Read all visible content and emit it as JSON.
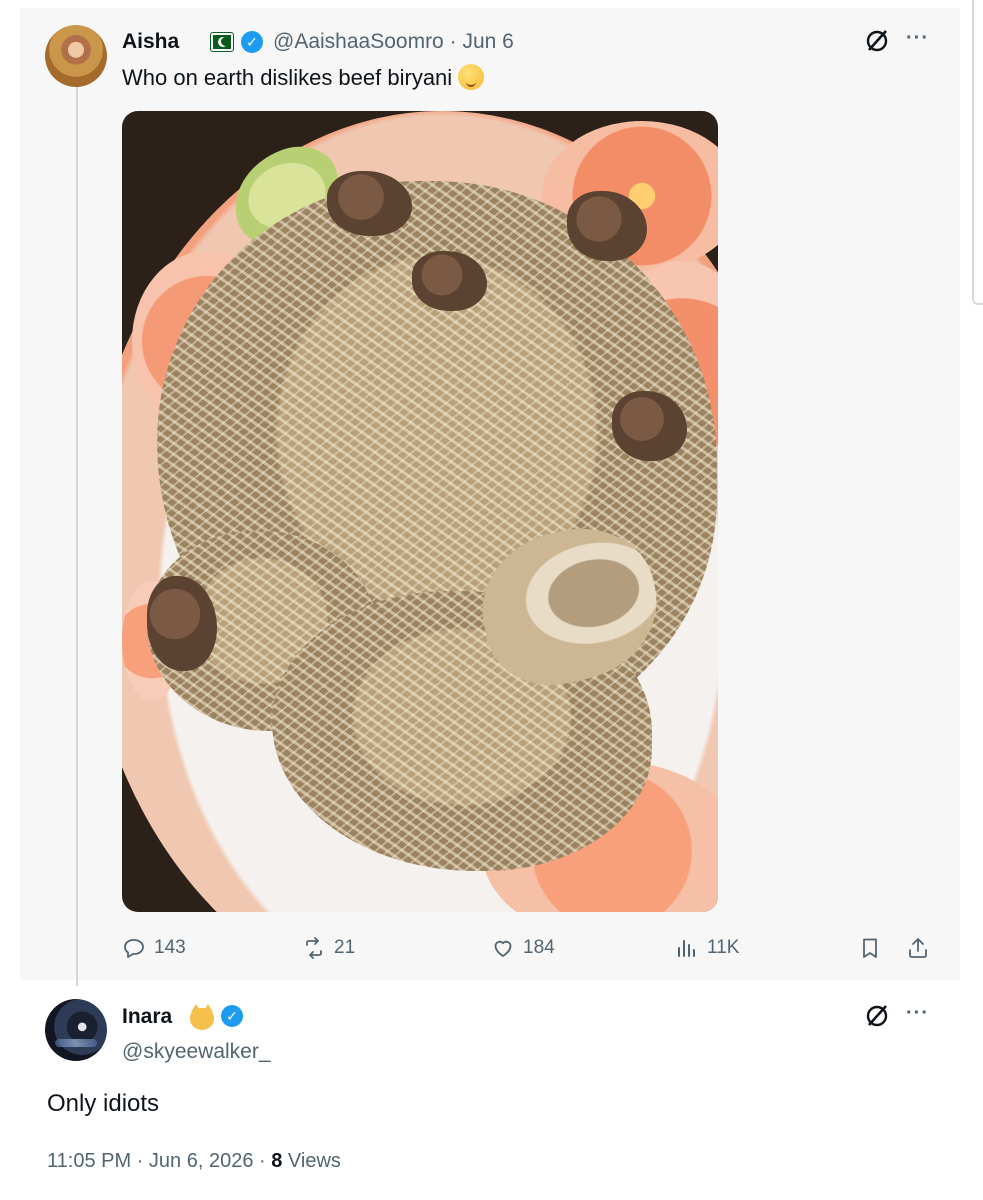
{
  "parent_tweet": {
    "author_name": "Aisha",
    "author_handle": "@AaishaaSoomro",
    "separator": "·",
    "date": "Jun 6",
    "text": "Who on earth dislikes beef biryani",
    "image_alt": "plate of beef biryani",
    "stats": {
      "replies": "143",
      "reposts": "21",
      "likes": "184",
      "views": "11K"
    }
  },
  "reply_tweet": {
    "author_name": "Inara",
    "author_handle": "@skyeewalker_",
    "text": "Only idiots",
    "time": "11:05 PM",
    "date": "Jun 6, 2026",
    "views_count": "8",
    "views_label": "Views"
  },
  "colors": {
    "verified": "#1d9bf0",
    "secondary_text": "#536471",
    "primary_text": "#0f1419",
    "thread_line": "#cfd9de"
  },
  "icons": [
    "grok-icon",
    "more-icon",
    "reply-icon",
    "repost-icon",
    "like-icon",
    "views-icon",
    "bookmark-icon",
    "share-icon",
    "verified-badge-icon",
    "pakistan-flag-icon",
    "drooling-face-emoji",
    "cat-face-emoji"
  ]
}
